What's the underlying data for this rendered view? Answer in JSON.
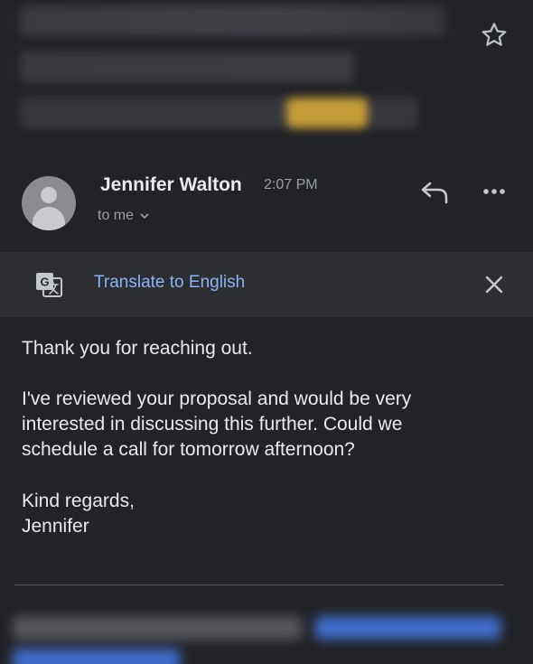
{
  "header": {
    "star_icon": "star-outline-icon"
  },
  "sender": {
    "name": "Jennifer Walton",
    "time": "2:07 PM",
    "recipient": "to me",
    "avatar_icon": "person-avatar-icon",
    "reply_icon": "reply-icon",
    "more_icon": "more-horizontal-icon"
  },
  "translate_bar": {
    "icon": "google-translate-icon",
    "label": "Translate to English",
    "close_icon": "close-icon"
  },
  "body": {
    "paragraph_1": "Thank you for reaching out.",
    "paragraph_2": "I've reviewed your proposal and would be very\ninterested in discussing this further. Could we\nschedule a call for tomorrow afternoon?",
    "paragraph_3": "Kind regards,\nJennifer"
  },
  "colors": {
    "background": "#222327",
    "translate_bar": "#2c2e32",
    "link": "#8ab4f8",
    "text": "#e8eaed",
    "muted_text": "#9aa0a6",
    "badge": "#e2b23a"
  }
}
